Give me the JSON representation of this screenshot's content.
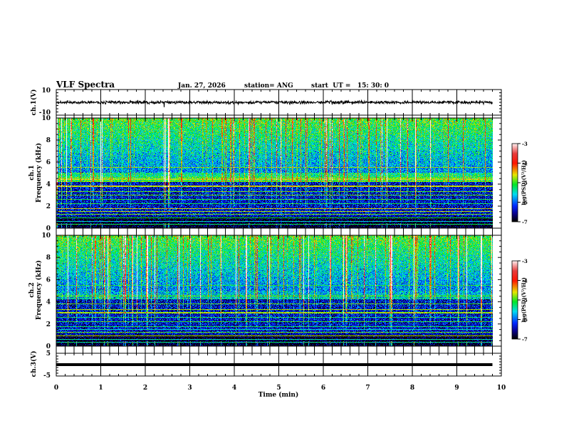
{
  "header": {
    "title": "VLF Spectra",
    "date": "Jan. 27, 2026",
    "station": "station= ANG",
    "start": "start  UT =   15: 30: 0"
  },
  "chart_data": [
    {
      "type": "line",
      "ylabel": "ch.1(V)",
      "ylim": [
        -10,
        10
      ],
      "yticks": [
        "10",
        "-10"
      ],
      "level": 0
    },
    {
      "type": "heatmap",
      "ylabel_top": "ch.1",
      "ylabel": "Frequency (kHz)",
      "ylim": [
        0,
        10
      ],
      "xlim": [
        0,
        10
      ],
      "yticks": [
        "0",
        "2",
        "4",
        "6",
        "8",
        "10"
      ],
      "colorbar": {
        "label": "log(PSD)(V²/Hz)",
        "range": [
          -7,
          -3
        ],
        "ticks": [
          "-3",
          "-4",
          "-5",
          "-6",
          "-7"
        ]
      }
    },
    {
      "type": "heatmap",
      "ylabel_top": "ch.2",
      "ylabel": "Frequency (kHz)",
      "ylim": [
        0,
        10
      ],
      "xlim": [
        0,
        10
      ],
      "yticks": [
        "0",
        "2",
        "4",
        "6",
        "8",
        "10"
      ],
      "colorbar": {
        "label": "log(PSD)(V²/Hz)",
        "range": [
          -7,
          -3
        ],
        "ticks": [
          "-3",
          "-4",
          "-5",
          "-6",
          "-7"
        ]
      }
    },
    {
      "type": "line",
      "ylabel": "ch.3(V)",
      "ylim": [
        -5,
        5
      ],
      "yticks": [
        "5",
        "-5"
      ],
      "level": 0
    }
  ],
  "xaxis": {
    "label": "Time (min)",
    "xlim": [
      0,
      10
    ],
    "ticks": [
      "0",
      "1",
      "2",
      "3",
      "4",
      "5",
      "6",
      "7",
      "8",
      "9",
      "10"
    ],
    "data_end": 9.8
  }
}
